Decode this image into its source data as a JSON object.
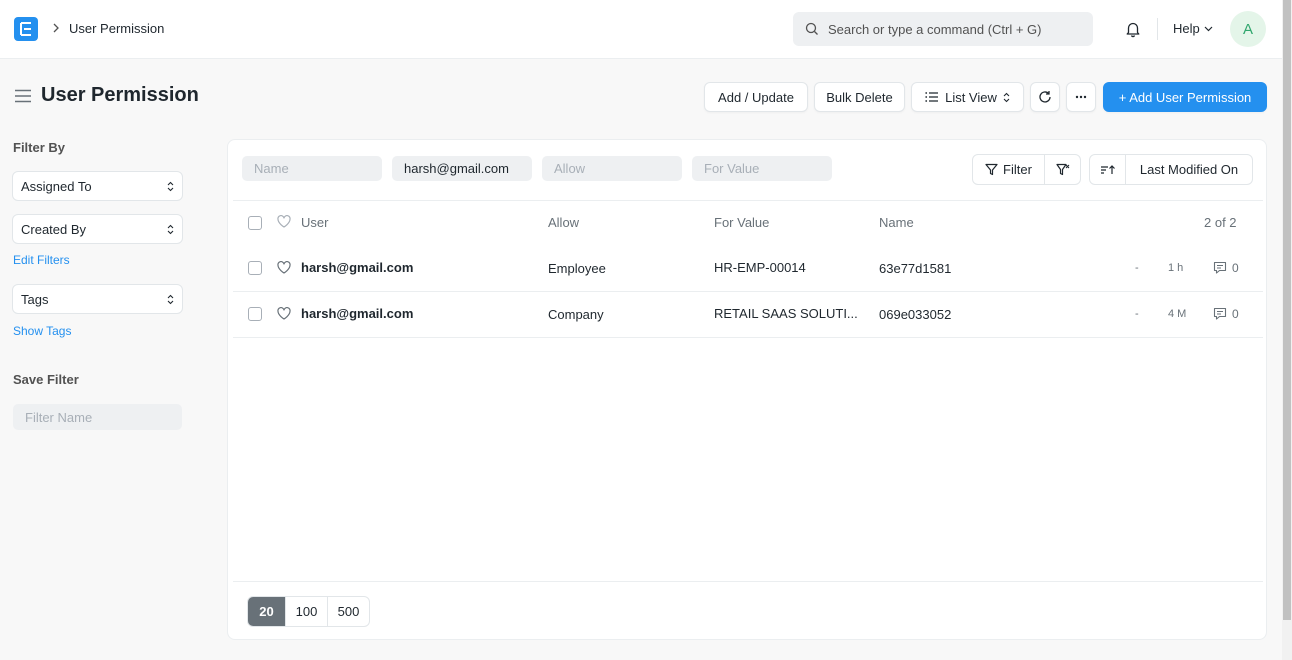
{
  "navbar": {
    "breadcrumb": "User Permission",
    "search_placeholder": "Search or type a command (Ctrl + G)",
    "help_label": "Help",
    "avatar_initial": "A"
  },
  "page": {
    "title": "User Permission",
    "buttons": {
      "add_update": "Add / Update",
      "bulk_delete": "Bulk Delete",
      "list_view": "List View",
      "add_primary": "+ Add User Permission"
    }
  },
  "sidebar": {
    "filter_by_label": "Filter By",
    "assigned_to": "Assigned To",
    "created_by": "Created By",
    "edit_filters": "Edit Filters",
    "tags": "Tags",
    "show_tags": "Show Tags",
    "save_filter_label": "Save Filter",
    "filter_name_placeholder": "Filter Name"
  },
  "filters": {
    "name_placeholder": "Name",
    "user_value": "harsh@gmail.com",
    "allow_placeholder": "Allow",
    "for_value_placeholder": "For Value",
    "filter_label": "Filter",
    "sort_label": "Last Modified On"
  },
  "table": {
    "columns": {
      "user": "User",
      "allow": "Allow",
      "for_value": "For Value",
      "name": "Name"
    },
    "count": "2 of 2",
    "rows": [
      {
        "user": "harsh@gmail.com",
        "allow": "Employee",
        "for_value": "HR-EMP-00014",
        "name": "63e77d1581",
        "dash": "-",
        "modified": "1 h",
        "comments": "0"
      },
      {
        "user": "harsh@gmail.com",
        "allow": "Company",
        "for_value": "RETAIL SAAS SOLUTI...",
        "name": "069e033052",
        "dash": "-",
        "modified": "4 M",
        "comments": "0"
      }
    ]
  },
  "pagination": {
    "options": [
      "20",
      "100",
      "500"
    ],
    "selected": "20"
  },
  "colors": {
    "primary": "#2490ef",
    "text": "#1f272e",
    "muted": "#687178",
    "background": "#f8f8f8"
  }
}
